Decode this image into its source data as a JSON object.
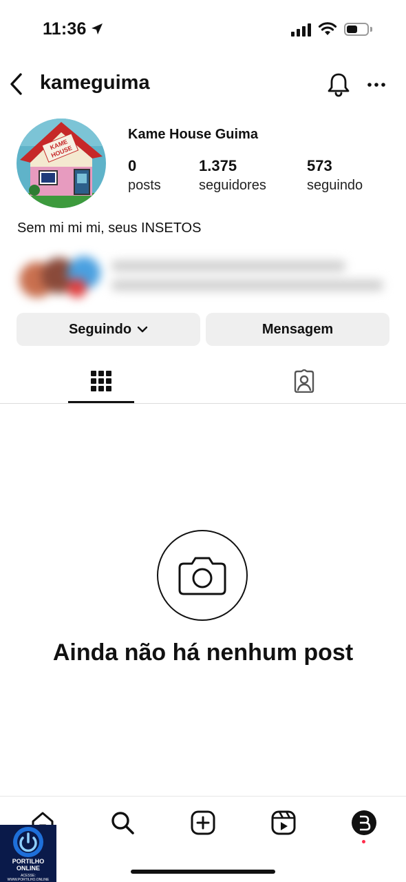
{
  "status_bar": {
    "time": "11:36",
    "signal_bars": 4,
    "battery_level_percent": 40
  },
  "header": {
    "username": "kameguima"
  },
  "profile": {
    "avatar_text": "KAME HOUSE",
    "display_name": "Kame House Guima",
    "stats": [
      {
        "value": "0",
        "label": "posts"
      },
      {
        "value": "1.375",
        "label": "seguidores"
      },
      {
        "value": "573",
        "label": "seguindo"
      }
    ],
    "bio": "Sem mi mi mi, seus INSETOS"
  },
  "actions": {
    "following_label": "Seguindo",
    "message_label": "Mensagem"
  },
  "tabs": [
    {
      "icon": "grid-icon",
      "active": true
    },
    {
      "icon": "tagged-icon",
      "active": false
    }
  ],
  "empty_state": {
    "icon": "camera-icon",
    "text": "Ainda não há nenhum post"
  },
  "bottom_nav": [
    {
      "icon": "home-icon"
    },
    {
      "icon": "search-icon"
    },
    {
      "icon": "create-icon"
    },
    {
      "icon": "reels-icon"
    },
    {
      "icon": "profile-icon"
    }
  ],
  "watermark": {
    "line1": "PORTILHO",
    "line2": "ONLINE",
    "line3": "ACESSE: WWW.PORTILHO.ONLINE"
  },
  "colors": {
    "button_bg": "#efefef",
    "text": "#111111",
    "notification_dot": "#ff2c4b"
  }
}
